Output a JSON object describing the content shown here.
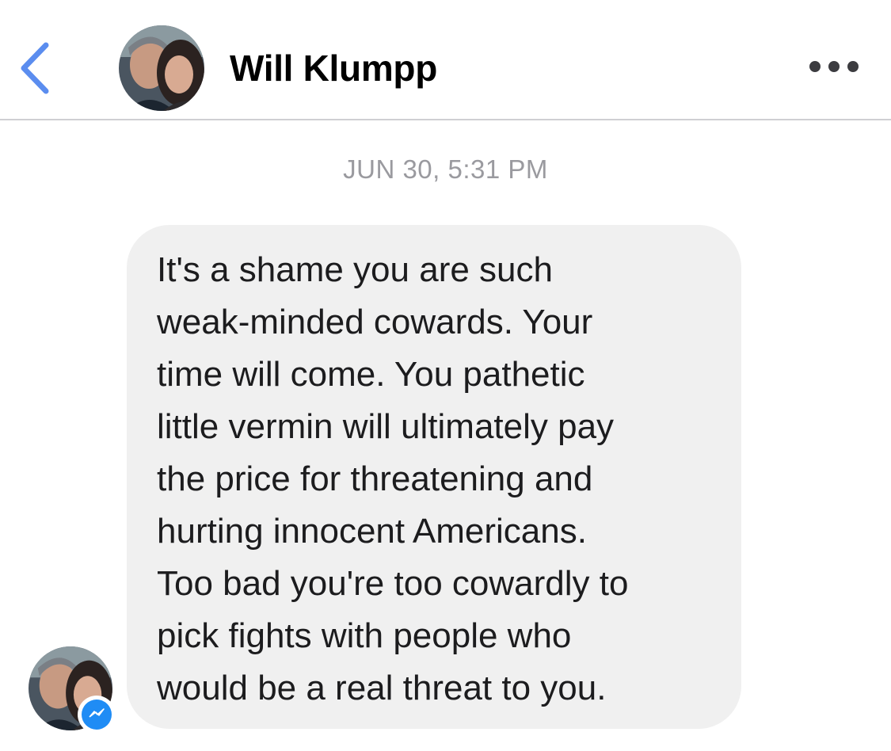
{
  "header": {
    "back_icon": "chevron-left-icon",
    "contact_name": "Will Klumpp",
    "more_icon": "ellipsis-icon",
    "avatar_icon": "profile-photo"
  },
  "conversation": {
    "timestamp": "JUN 30, 5:31 PM",
    "messages": [
      {
        "text": "It's a shame you are such\nweak-minded cowards. Your\ntime will come. You pathetic\nlittle vermin will ultimately pay\nthe price for threatening and\nhurting innocent Americans.\nToo bad you're too cowardly to\npick fights with people who\nwould be a real threat to you.",
        "badge_icon": "messenger-icon"
      }
    ]
  },
  "colors": {
    "accent": "#5b8def",
    "bubble": "#f0f0f0",
    "timestamp": "#9a9a9f",
    "messenger": "#1f8cf5"
  }
}
